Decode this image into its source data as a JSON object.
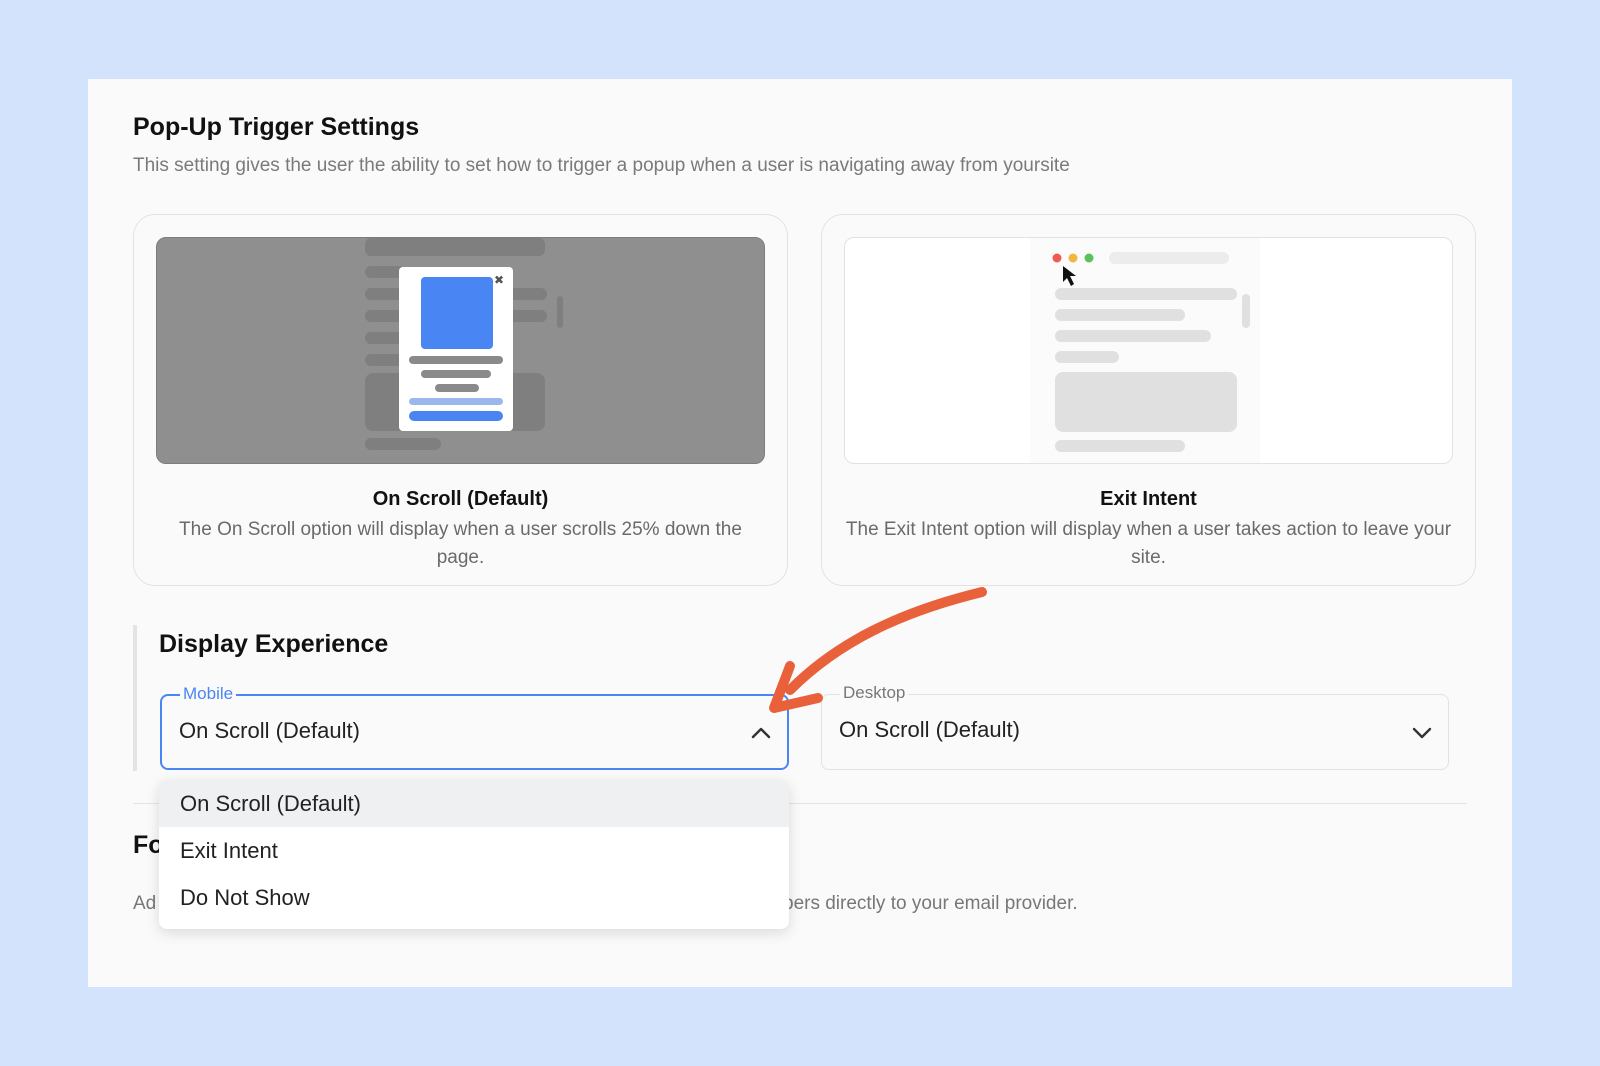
{
  "header": {
    "title": "Pop-Up Trigger Settings",
    "subtitle": "This setting gives the user the ability to set how to trigger a popup when a user is navigating away from yoursite"
  },
  "cards": [
    {
      "title": "On Scroll (Default)",
      "description": "The On Scroll option will display when a user scrolls 25% down the page."
    },
    {
      "title": "Exit Intent",
      "description": "The Exit Intent option will display when a user takes action to leave your site."
    }
  ],
  "display_experience": {
    "title": "Display Experience",
    "mobile": {
      "label": "Mobile",
      "value": "On Scroll (Default)"
    },
    "desktop": {
      "label": "Desktop",
      "value": "On Scroll (Default)"
    }
  },
  "dropdown": {
    "options": [
      "On Scroll (Default)",
      "Exit Intent",
      "Do Not Show"
    ],
    "selected_index": 0
  },
  "next_section": {
    "title_visible": "Fo",
    "desc_left": "Ad",
    "desc_right": "bers directly to your email provider."
  },
  "colors": {
    "accent": "#4a86f3",
    "annotation_arrow": "#e8613a",
    "background": "#d3e3fb"
  }
}
